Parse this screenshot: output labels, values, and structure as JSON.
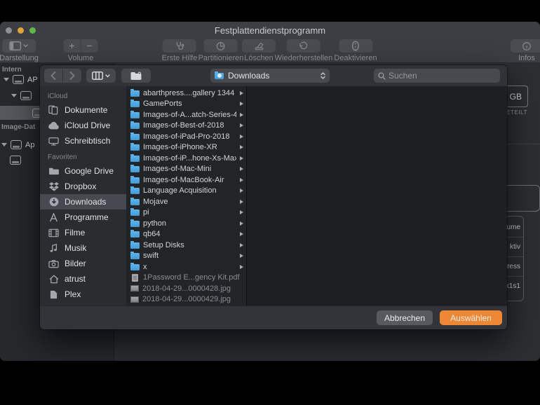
{
  "window": {
    "title": "Festplattendienstprogramm",
    "toolbar": [
      {
        "id": "darstellung",
        "label": "Darstellung",
        "icon": "sidebar-pane-icon"
      },
      {
        "id": "volume",
        "label": "Volume",
        "icons": [
          "plus",
          "minus"
        ]
      },
      {
        "id": "erstehilfe",
        "label": "Erste Hilfe",
        "icon": "stethoscope-icon"
      },
      {
        "id": "partitionieren",
        "label": "Partitionieren",
        "icon": "partition-pie-icon"
      },
      {
        "id": "loeschen",
        "label": "Löschen",
        "icon": "erase-icon"
      },
      {
        "id": "wiederherstellen",
        "label": "Wiederherstellen",
        "icon": "restore-arrow-icon"
      },
      {
        "id": "deaktivieren",
        "label": "Deaktivieren",
        "icon": "unmount-icon"
      },
      {
        "id": "infos",
        "label": "Infos",
        "icon": "info-circle-icon"
      }
    ]
  },
  "background": {
    "sidebar": {
      "section1": "Intern",
      "disk1": "AP",
      "section2": "Image-Dat",
      "disk2": "Ap"
    },
    "details": {
      "size_unit": "GB",
      "partition_label": "ETEILT",
      "values": [
        "ume",
        "ktiv",
        "ress",
        "k1s1"
      ]
    }
  },
  "dialog": {
    "nav": {
      "path_value": "Downloads",
      "search_placeholder": "Suchen"
    },
    "sidebar": [
      {
        "header": "iCloud",
        "items": [
          {
            "label": "Dokumente",
            "icon": "documents-icon"
          },
          {
            "label": "iCloud Drive",
            "icon": "icloud-drive-icon"
          },
          {
            "label": "Schreibtisch",
            "icon": "desktop-icon"
          }
        ]
      },
      {
        "header": "Favoriten",
        "items": [
          {
            "label": "Google Drive",
            "icon": "folder-gray-icon"
          },
          {
            "label": "Dropbox",
            "icon": "dropbox-icon"
          },
          {
            "label": "Downloads",
            "icon": "downloads-circle-icon",
            "selected": true
          },
          {
            "label": "Programme",
            "icon": "applications-icon"
          },
          {
            "label": "Filme",
            "icon": "movies-icon"
          },
          {
            "label": "Musik",
            "icon": "music-icon"
          },
          {
            "label": "Bilder",
            "icon": "pictures-icon"
          },
          {
            "label": "atrust",
            "icon": "home-icon"
          },
          {
            "label": "Plex",
            "icon": "document-icon"
          }
        ]
      }
    ],
    "files": [
      {
        "name": "abarthpress....gallery 1344",
        "type": "folder"
      },
      {
        "name": "GamePorts",
        "type": "folder"
      },
      {
        "name": "Images-of-A...atch-Series-4",
        "type": "folder"
      },
      {
        "name": "Images-of-Best-of-2018",
        "type": "folder"
      },
      {
        "name": "Images-of-iPad-Pro-2018",
        "type": "folder"
      },
      {
        "name": "Images-of-iPhone-XR",
        "type": "folder"
      },
      {
        "name": "Images-of-iP...hone-Xs-Max",
        "type": "folder"
      },
      {
        "name": "Images-of-Mac-Mini",
        "type": "folder"
      },
      {
        "name": "Images-of-MacBook-Air",
        "type": "folder"
      },
      {
        "name": "Language Acquisition",
        "type": "folder"
      },
      {
        "name": "Mojave",
        "type": "folder"
      },
      {
        "name": "pi",
        "type": "folder"
      },
      {
        "name": "python",
        "type": "folder"
      },
      {
        "name": "qb64",
        "type": "folder"
      },
      {
        "name": "Setup Disks",
        "type": "folder"
      },
      {
        "name": "swift",
        "type": "folder"
      },
      {
        "name": "x",
        "type": "folder"
      },
      {
        "name": "1Password E...gency Kit.pdf",
        "type": "pdf"
      },
      {
        "name": "2018-04-29...0000428.jpg",
        "type": "image"
      },
      {
        "name": "2018-04-29...0000429.jpg",
        "type": "image"
      }
    ],
    "buttons": {
      "cancel": "Abbrechen",
      "confirm": "Auswählen"
    },
    "colors": {
      "accent": "#ED8733",
      "folder_blue": "#429BD8",
      "selection_gray": "#46494F"
    }
  }
}
